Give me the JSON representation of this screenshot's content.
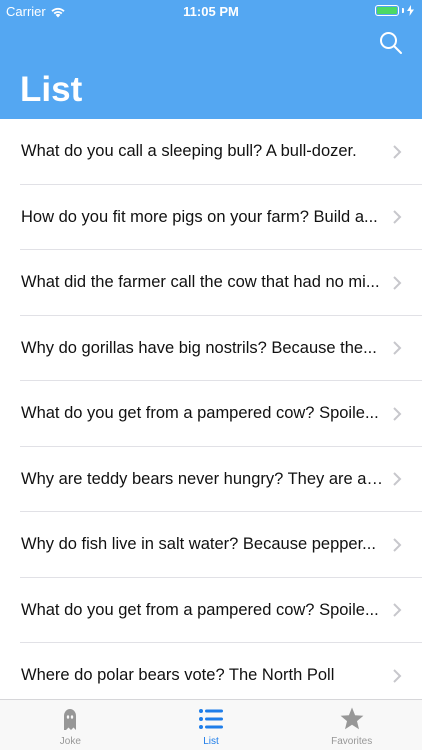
{
  "status_bar": {
    "carrier": "Carrier",
    "time": "11:05 PM",
    "battery_color": "#4cd964"
  },
  "header": {
    "title": "List",
    "background": "#54a7f2",
    "search_icon": "search-icon"
  },
  "jokes": [
    {
      "text": "What do you call a sleeping bull? A bull-dozer."
    },
    {
      "text": "How do you fit more pigs on your farm? Build a..."
    },
    {
      "text": "What did the farmer call the cow that had no mi..."
    },
    {
      "text": "Why do gorillas have big nostrils? Because the..."
    },
    {
      "text": "What do you get from a pampered cow? Spoile..."
    },
    {
      "text": "Why are teddy bears never hungry? They are al..."
    },
    {
      "text": "Why do fish live in salt water? Because pepper..."
    },
    {
      "text": "What do you get from a pampered cow?  Spoile..."
    },
    {
      "text": "Where do polar bears vote?  The North Poll"
    }
  ],
  "tabbar": {
    "tabs": [
      {
        "label": "Joke",
        "icon": "ghost-icon",
        "active": false
      },
      {
        "label": "List",
        "icon": "list-icon",
        "active": true
      },
      {
        "label": "Favorites",
        "icon": "star-icon",
        "active": false
      }
    ],
    "active_color": "#1e7de9",
    "inactive_color": "#979797"
  }
}
